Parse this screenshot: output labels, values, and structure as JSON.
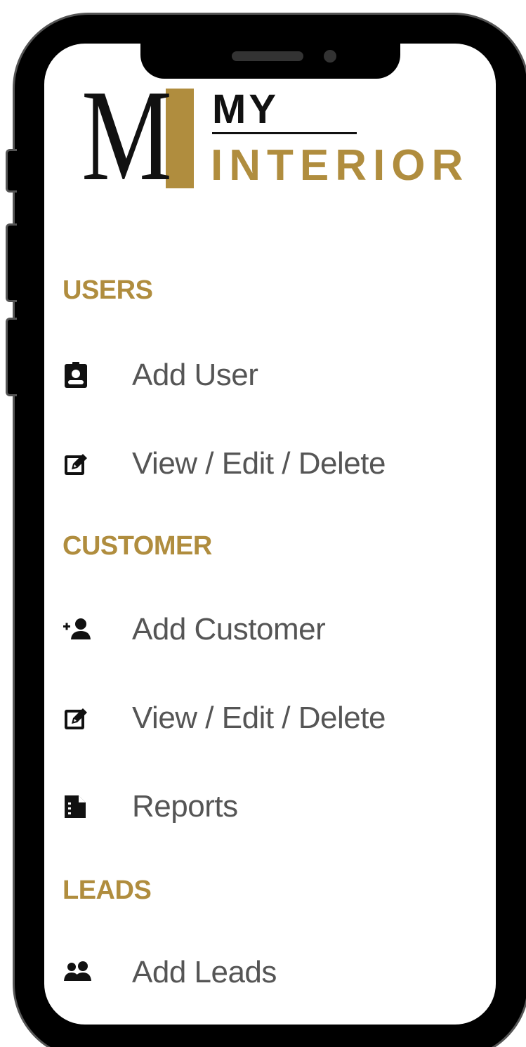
{
  "brand": {
    "logo_letter": "M",
    "logo_top": "MY",
    "logo_bottom": "INTERIOR",
    "gold": "#b08d3e"
  },
  "menu": {
    "sections": [
      {
        "title": "USERS",
        "items": [
          {
            "label": "Add User",
            "icon": "user-badge-icon"
          },
          {
            "label": "View / Edit / Delete",
            "icon": "edit-icon"
          }
        ]
      },
      {
        "title": "CUSTOMER",
        "items": [
          {
            "label": "Add Customer",
            "icon": "user-plus-icon"
          },
          {
            "label": "View / Edit / Delete",
            "icon": "edit-icon"
          },
          {
            "label": "Reports",
            "icon": "file-icon"
          }
        ]
      },
      {
        "title": "LEADS",
        "items": [
          {
            "label": "Add Leads",
            "icon": "users-icon"
          }
        ]
      }
    ]
  }
}
